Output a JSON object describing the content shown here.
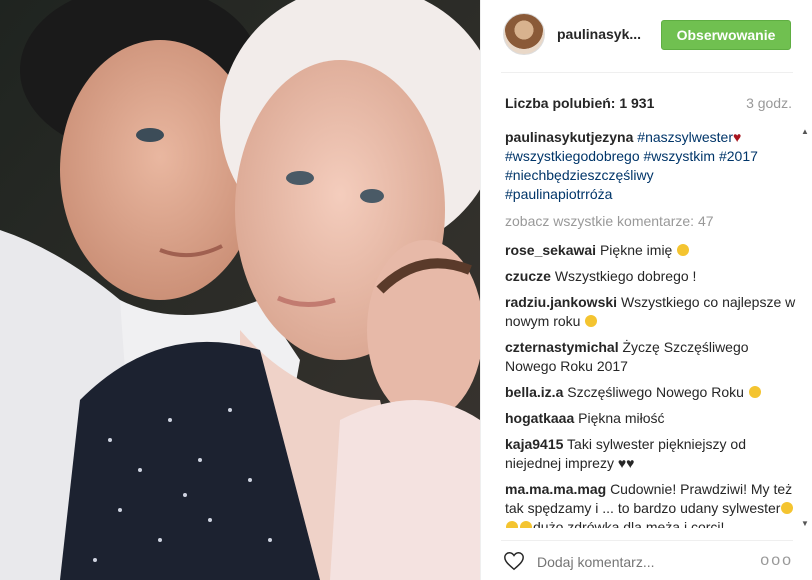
{
  "post": {
    "username": "paulinasyk...",
    "follow_label": "Obserwowanie",
    "likes": "Liczba polubień: 1 931",
    "time": "3 godz.",
    "view_all": "zobacz wszystkie komentarze: 47",
    "add_comment_placeholder": "Dodaj komentarz...",
    "more": "ooo"
  },
  "caption": {
    "user": "paulinasykutjezyna",
    "line1_tag": "#naszsylwester",
    "line2": "#wszystkiegodobrego #wszystkim #2017",
    "line3": "#niechbędzieszczęśliwy",
    "line4": "#paulinapiotrróża"
  },
  "comments": [
    {
      "user": "rose_sekawai",
      "text": "Piękne imię"
    },
    {
      "user": "czucze",
      "text": "Wszystkiego dobrego !"
    },
    {
      "user": "radziu.jankowski",
      "text": "Wszystkiego co najlepsze w nowym roku"
    },
    {
      "user": "czternastymichal",
      "text": "Życzę Szczęśliwego Nowego Roku 2017"
    },
    {
      "user": "bella.iz.a",
      "text": "Szczęśliwego Nowego Roku"
    },
    {
      "user": "hogatkaaa",
      "text": "Piękna miłość"
    },
    {
      "user": "kaja9415",
      "text": "Taki sylwester piękniejszy od niejednej imprezy"
    },
    {
      "user": "ma.ma.ma.mag",
      "text": "Cudownie! Prawdziwi! My też tak spędzamy i ... to bardzo udany sylwester",
      "text2": "dużo zdrówka dla męża i corci!"
    }
  ],
  "colors": {
    "follow": "#70c050",
    "hashtag": "#003569",
    "muted": "#999999"
  }
}
